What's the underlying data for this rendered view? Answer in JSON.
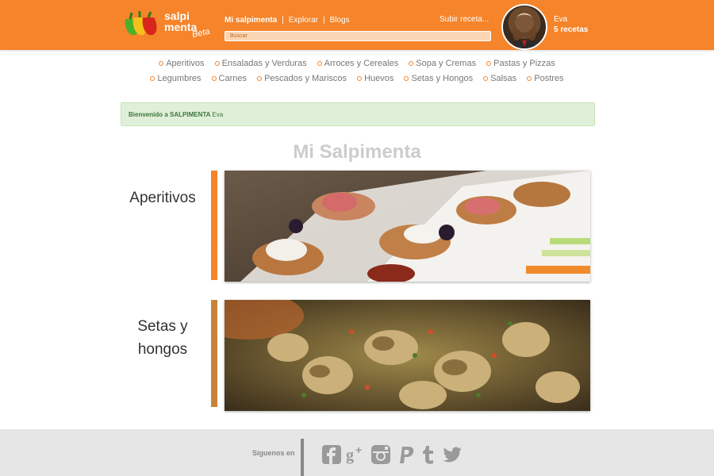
{
  "header": {
    "logo_line1": "salpi",
    "logo_line2": "menta",
    "logo_beta": "Beta",
    "nav": [
      "Mi salpimenta",
      "Explorar",
      "Blogs"
    ],
    "search_placeholder": "Buscar",
    "upload_label": "Subir receta...",
    "user_name": "Eva",
    "user_recipes": "5 recetas"
  },
  "categories_row1": [
    "Aperitivos",
    "Ensaladas y Verduras",
    "Arroces y Cereales",
    "Sopa y Cremas",
    "Pastas y Pizzas"
  ],
  "categories_row2": [
    "Legumbres",
    "Carnes",
    "Pescados y Mariscos",
    "Huevos",
    "Setas y Hongos",
    "Salsas",
    "Postres"
  ],
  "welcome": {
    "text": "Bienvenido a SALPIMENTA",
    "user": "Eva"
  },
  "page_title": "Mi Salpimenta",
  "blocks": [
    {
      "label": "Aperitivos",
      "bar_color": "#f5842a"
    },
    {
      "label": "Setas y hongos",
      "bar_color": "#c8833a"
    }
  ],
  "footer": {
    "follow_label": "Síguenos en",
    "social": [
      "facebook-icon",
      "google-plus-icon",
      "instagram-icon",
      "paypal-icon",
      "tumblr-icon",
      "twitter-icon"
    ]
  },
  "colors": {
    "brand": "#f5842a",
    "welcome_bg": "#e0f0d8",
    "welcome_text": "#3c763d"
  }
}
